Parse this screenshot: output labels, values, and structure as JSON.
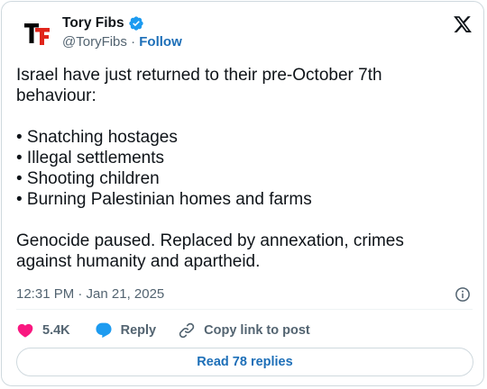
{
  "author": {
    "display_name": "Tory Fibs",
    "handle": "@ToryFibs",
    "separator": "·",
    "follow_label": "Follow",
    "avatar_icon": "tory-fibs-logo",
    "verified_icon": "verified-badge-icon",
    "verified_color": "#1d9bf0"
  },
  "platform_icon": "x-logo-icon",
  "tweet": {
    "intro_line1": "Israel have just returned to their pre-October 7th",
    "intro_line2": "behaviour:",
    "bullets": [
      "• Snatching hostages",
      "• Illegal settlements",
      "• Shooting children",
      "• Burning Palestinian homes and farms"
    ],
    "closing_line1": "Genocide paused. Replaced by annexation, crimes",
    "closing_line2": "against humanity and apartheid."
  },
  "timestamp": "12:31 PM · Jan 21, 2025",
  "info_icon": "info-icon",
  "actions": {
    "like_count": "5.4K",
    "reply_label": "Reply",
    "copy_label": "Copy link to post"
  },
  "read_replies_label": "Read 78 replies",
  "colors": {
    "like_red": "#f91880",
    "reply_blue": "#1d9bf0",
    "link_blue": "#1d6fb8",
    "secondary_text": "#536471",
    "brand_red": "#e0251b"
  }
}
